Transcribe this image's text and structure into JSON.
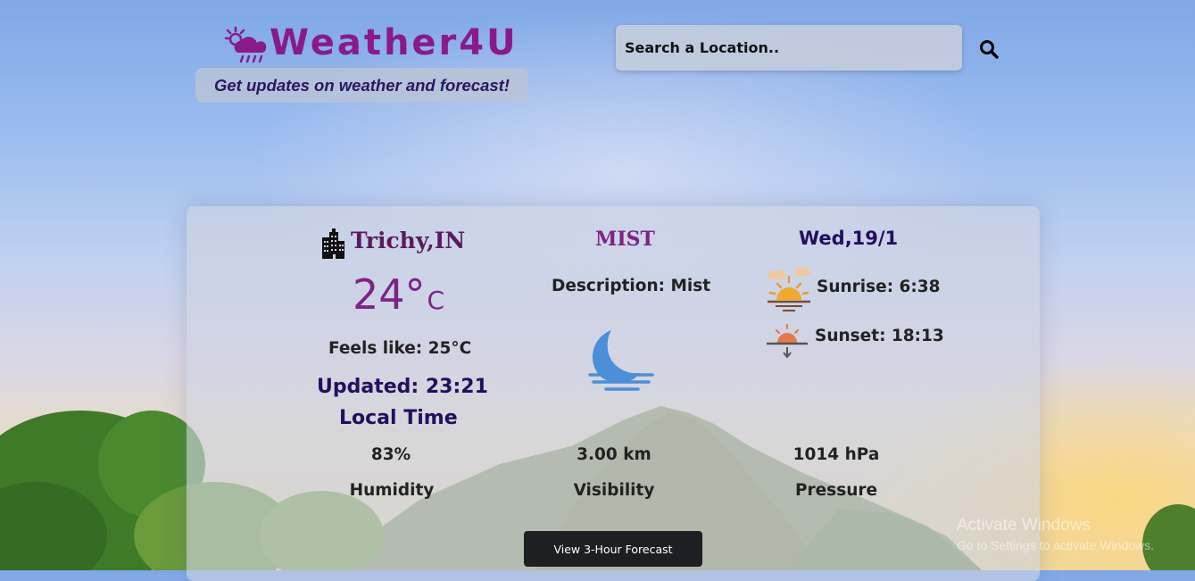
{
  "header": {
    "app_title": "Weather4U",
    "tagline": "Get updates on weather and forecast!",
    "logo_icon": "sun-cloud-rain-icon"
  },
  "search": {
    "placeholder": "Search a Location..",
    "button_icon": "search-icon"
  },
  "current": {
    "city": "Trichy,IN",
    "city_icon": "city-buildings-icon",
    "temperature": "24°",
    "temperature_unit": "C",
    "feels_like": "Feels like: 25°C",
    "updated": "Updated: 23:21",
    "local_time_label": "Local Time",
    "condition": "MIST",
    "description": "Description: Mist",
    "condition_icon": "moon-mist-icon",
    "date": "Wed,19/1",
    "sunrise": "Sunrise: 6:38",
    "sunrise_icon": "sunrise-icon",
    "sunset": "Sunset: 18:13",
    "sunset_icon": "sunset-icon"
  },
  "stats": [
    {
      "value": "83%",
      "label": "Humidity"
    },
    {
      "value": "3.00 km",
      "label": "Visibility"
    },
    {
      "value": "1014 hPa",
      "label": "Pressure"
    }
  ],
  "forecast_button": "View 3-Hour Forecast",
  "watermark": {
    "line1": "Activate Windows",
    "line2": "Go to Settings to activate Windows."
  },
  "colors": {
    "brand": "#8a1a8c",
    "heading": "#230f5e",
    "button_bg": "#1e1f23"
  }
}
